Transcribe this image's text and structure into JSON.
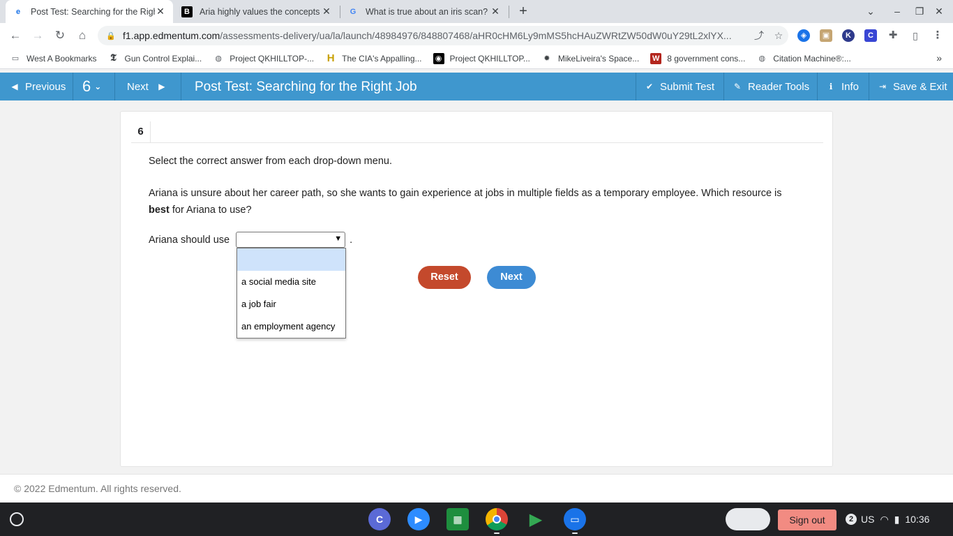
{
  "browser": {
    "tabs": [
      {
        "title": "Post Test: Searching for the Righ",
        "favicon": "edmentum-icon"
      },
      {
        "title": "Aria highly values the concepts o",
        "favicon": "brainly-icon"
      },
      {
        "title": "What is true about an iris scan?",
        "favicon": "google-icon"
      }
    ],
    "url_host": "f1.app.edmentum.com",
    "url_path": "/assessments-delivery/ua/la/launch/48984976/848807468/aHR0cHM6Ly9mMS5hcHAuZWRtZW50dW0uY29tL2xlYX...",
    "bookmarks": [
      "West A Bookmarks",
      "Gun Control Explai...",
      "Project QKHILLTOP-...",
      "The CIA's Appalling...",
      "Project QKHILLTOP...",
      "MikeLiveira's Space...",
      "8 government cons...",
      "Citation Machine®:..."
    ]
  },
  "header": {
    "previous_label": "Previous",
    "question_number": "6",
    "next_label": "Next",
    "title": "Post Test: Searching for the Right Job",
    "submit_label": "Submit Test",
    "reader_tools_label": "Reader Tools",
    "info_label": "Info",
    "save_exit_label": "Save & Exit"
  },
  "question": {
    "number": "6",
    "instruction": "Select the correct answer from each drop-down menu.",
    "text_before_bold": "Ariana is unsure about her career path, so she wants to gain experience at jobs in multiple fields as a temporary employee. Which resource is ",
    "bold_word": "best",
    "text_after_bold": " for Ariana to use?",
    "answer_prefix": "Ariana should use",
    "answer_suffix": ".",
    "dropdown_options": [
      "",
      "a social media site",
      "a job fair",
      "an employment agency"
    ],
    "reset_label": "Reset",
    "next_label": "Next"
  },
  "footer": {
    "copyright": "© 2022 Edmentum. All rights reserved."
  },
  "shelf": {
    "sign_out_label": "Sign out",
    "notification_count": "2",
    "keyboard_layout": "US",
    "time": "10:36"
  },
  "colors": {
    "header_blue": "#3f97ce",
    "reset_red": "#c4492c",
    "next_blue": "#3d8bd4",
    "dropdown_highlight": "#cfe3fb"
  }
}
